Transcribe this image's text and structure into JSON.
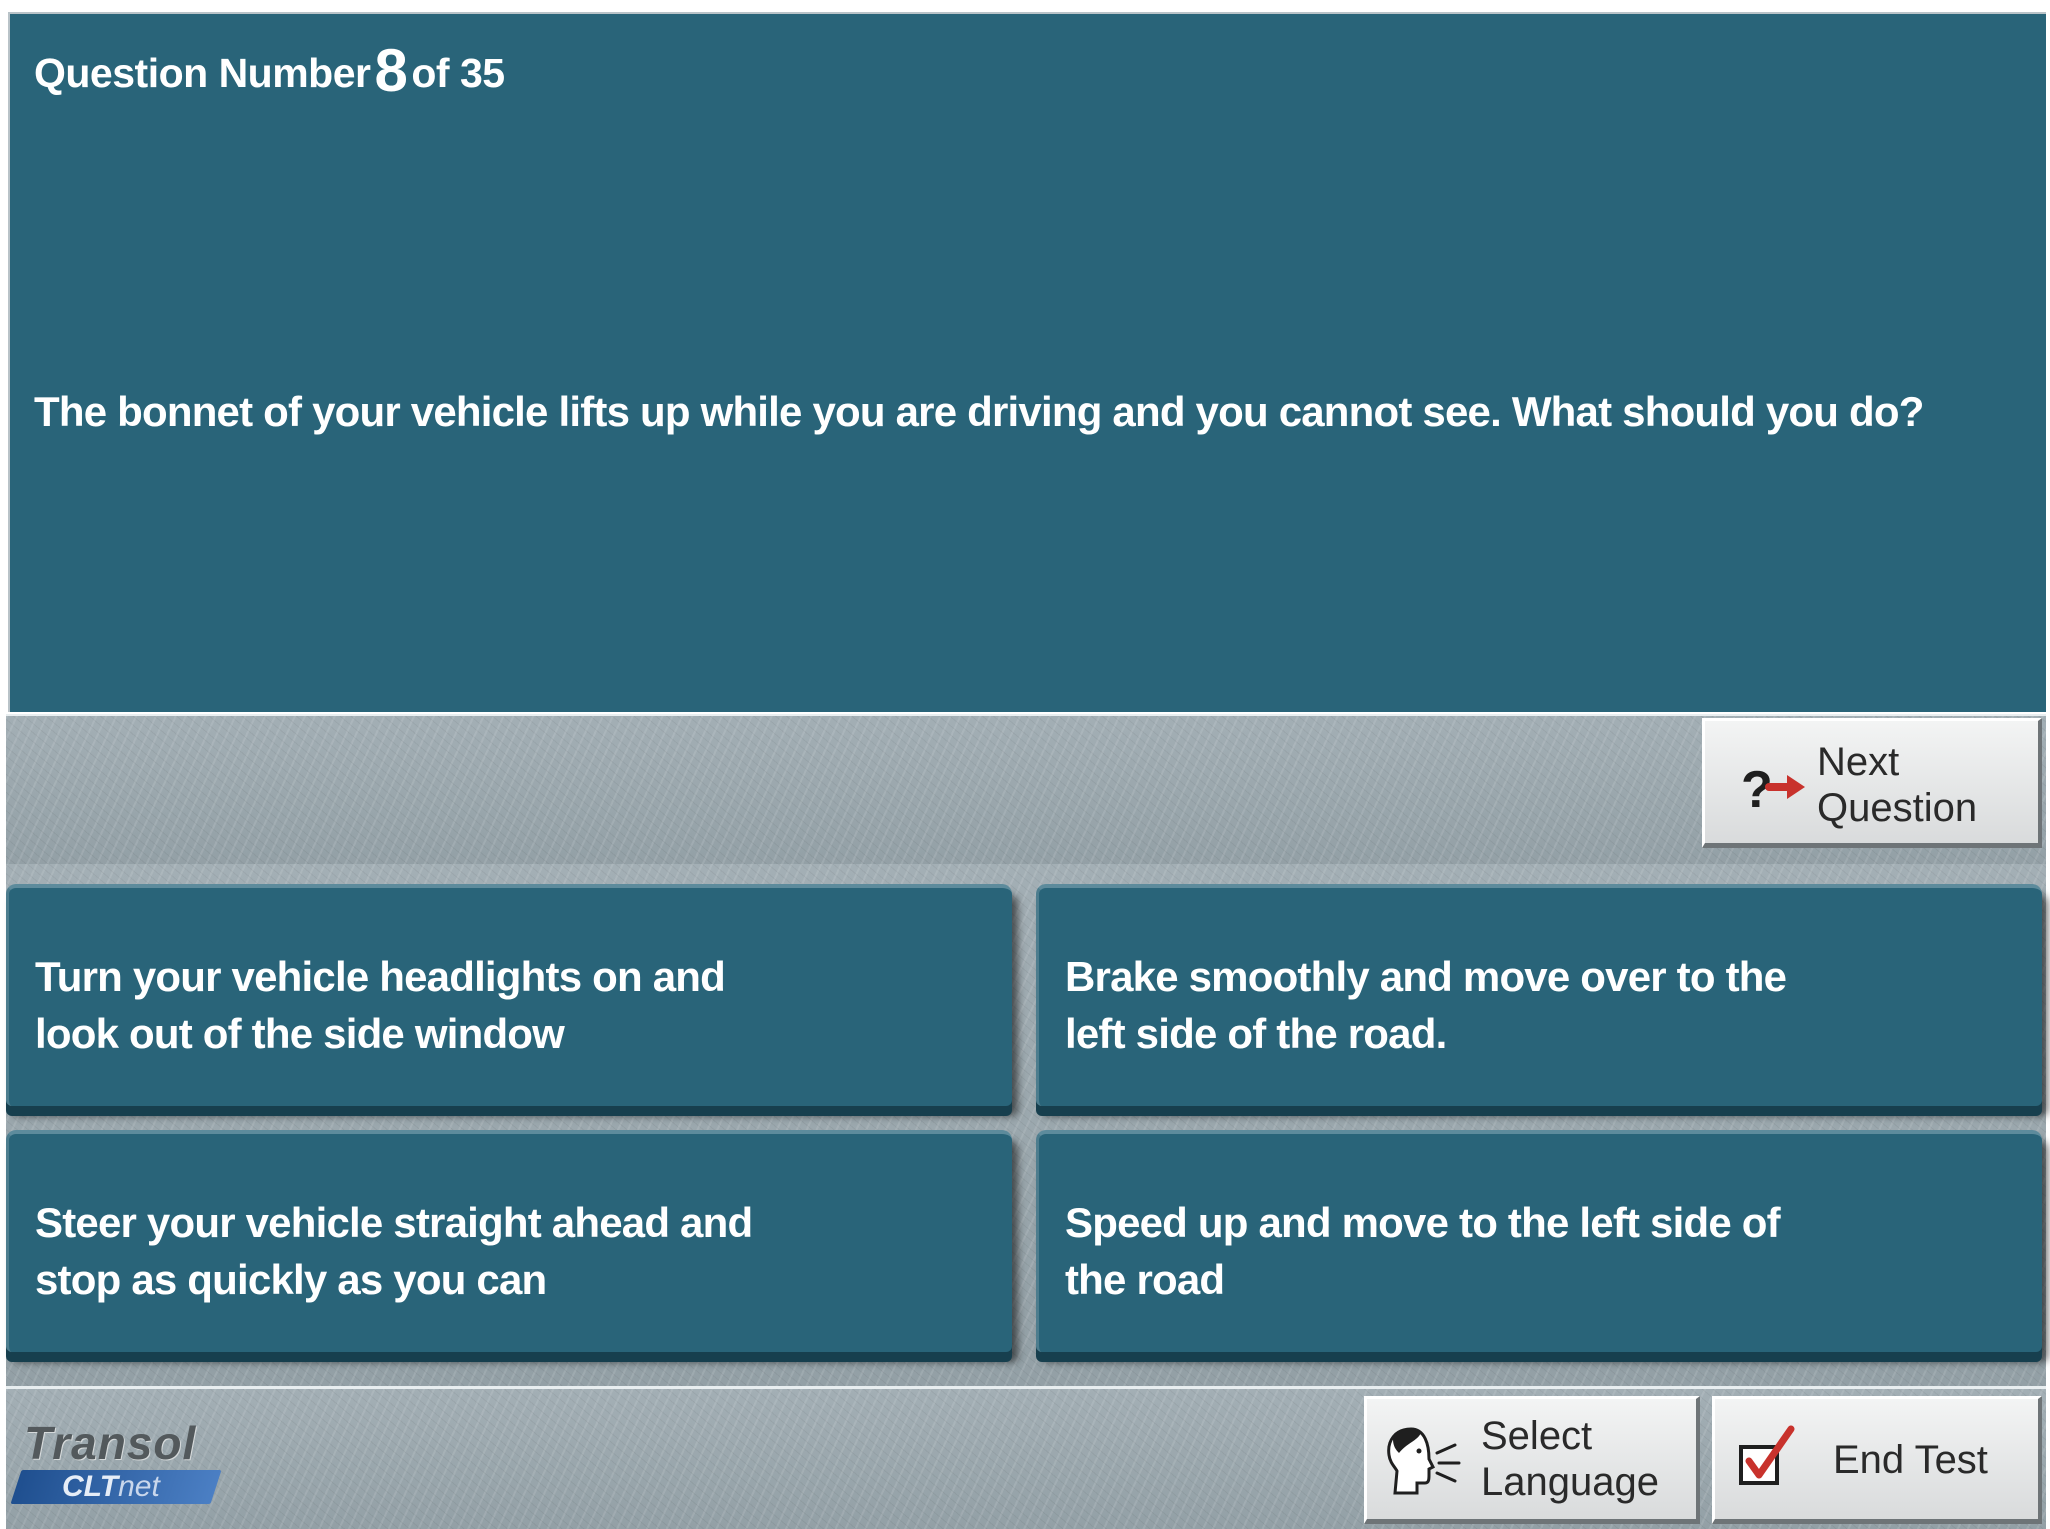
{
  "header": {
    "question_prefix": "Question Number",
    "question_current": "8",
    "question_of": "of 35"
  },
  "question": {
    "text": "The bonnet of your vehicle lifts up while you are driving and you cannot see. What should you do?"
  },
  "answers": [
    {
      "text": "Turn your vehicle headlights on and\nlook out of the side window"
    },
    {
      "text": "Brake smoothly and move over to the\nleft side of the road."
    },
    {
      "text": "Steer your vehicle straight ahead and\nstop as quickly as you can"
    },
    {
      "text": "Speed up and move to the left side of\nthe road"
    }
  ],
  "buttons": {
    "next_line1": "Next",
    "next_line2": "Question",
    "language_line1": "Select",
    "language_line2": "Language",
    "end_test": "End Test"
  },
  "logo": {
    "brand": "Transol",
    "product_bold": "CLT",
    "product_thin": "net"
  },
  "colors": {
    "panel_blue": "#296479",
    "arrow_red": "#c8322c",
    "checkmark_red": "#c8322c"
  },
  "icons": {
    "next": "question-arrow-icon",
    "language": "speaking-head-icon",
    "end_test": "checkbox-check-icon"
  }
}
